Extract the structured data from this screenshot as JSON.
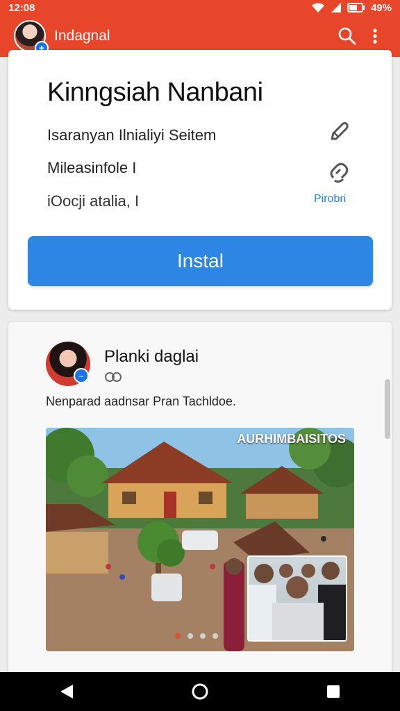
{
  "status_bar": {
    "time": "12:08",
    "battery": "49%",
    "icons": [
      "wifi-icon",
      "signal-icon",
      "battery-icon"
    ]
  },
  "app_bar": {
    "title": "Indagnal",
    "icons": [
      "search-icon",
      "more-vert-icon"
    ],
    "color": "#e8462a"
  },
  "install_card": {
    "title": "Kinngsiah Nanbani",
    "lines": [
      "Isaranyan Ilnialiyi Seitem",
      "Mileasinfole I",
      "iOocji atalia, I"
    ],
    "side_label": "Pirobri",
    "install_button": "Instal",
    "button_color": "#2d86e4"
  },
  "post": {
    "author": "Planki daglai",
    "caption": "Nenparad aadnsar Pran Tachldoe.",
    "image_overlay": "AURHIMBAISITOS",
    "carousel": {
      "count": 4,
      "active_index": 0
    }
  },
  "nav_bar": {
    "buttons": [
      "back-icon",
      "home-icon",
      "recents-icon"
    ]
  }
}
